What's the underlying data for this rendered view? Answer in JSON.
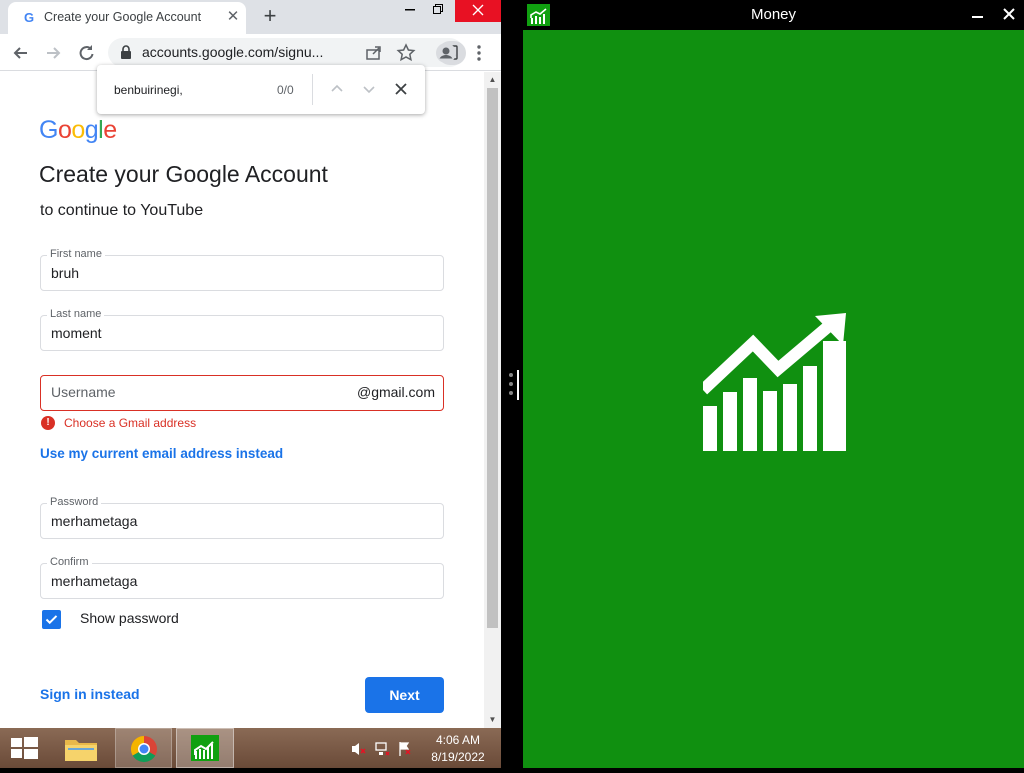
{
  "browser": {
    "tab_title": "Create your Google Account",
    "favicon_letter": "G",
    "url": "accounts.google.com/signu...",
    "find_query": "benbuirinegi,",
    "find_count": "0/0"
  },
  "page": {
    "logo_text": [
      "G",
      "o",
      "o",
      "g",
      "l",
      "e"
    ],
    "logo_colors": [
      "#4285f4",
      "#ea4335",
      "#fbbc05",
      "#4285f4",
      "#34a853",
      "#ea4335"
    ],
    "heading": "Create your Google Account",
    "subtitle": "to continue to YouTube",
    "first_name_label": "First name",
    "first_name_value": "bruh",
    "last_name_label": "Last name",
    "last_name_value": "moment",
    "username_placeholder": "Username",
    "username_suffix": "@gmail.com",
    "username_error": "Choose a Gmail address",
    "use_current_link": "Use my current email address instead",
    "password_label": "Password",
    "password_value": "merhametaga",
    "confirm_label": "Confirm",
    "confirm_value": "merhametaga",
    "show_password_label": "Show password",
    "show_password_checked": true,
    "signin_link": "Sign in instead",
    "next_button": "Next"
  },
  "taskbar": {
    "time": "4:06 AM",
    "date": "8/19/2022"
  },
  "money_app": {
    "title": "Money",
    "background": "#109010"
  }
}
